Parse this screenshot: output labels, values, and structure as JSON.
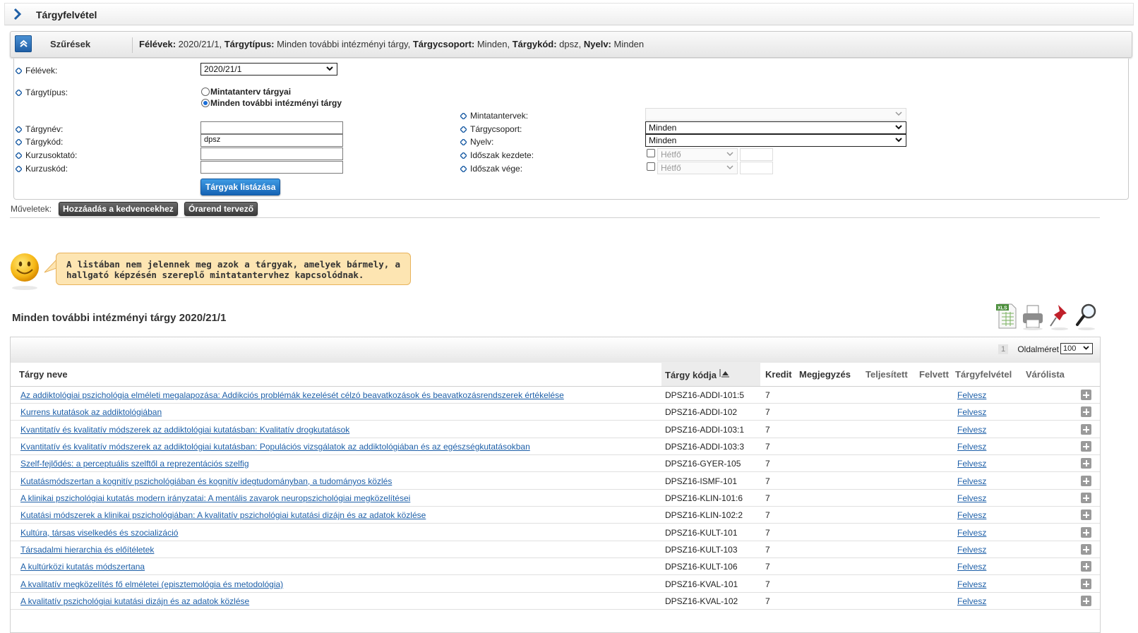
{
  "page": {
    "title": "Tárgyfelvétel"
  },
  "filter": {
    "label": "Szűrések",
    "summary": [
      {
        "key": "Félévek:",
        "value": " 2020/21/1, "
      },
      {
        "key": "Tárgytípus:",
        "value": " Minden további intézményi tárgy, "
      },
      {
        "key": "Tárgycsoport:",
        "value": " Minden, "
      },
      {
        "key": "Tárgykód:",
        "value": " dpsz, "
      },
      {
        "key": "Nyelv:",
        "value": " Minden"
      }
    ],
    "felevek_label": "Félévek:",
    "felevek_value": "2020/21/1",
    "targytipus_label": "Tárgytípus:",
    "radio_1": "Mintatanterv tárgyai",
    "radio_2": "Minden további intézményi tárgy",
    "targynev_label": "Tárgynév:",
    "targykod_label": "Tárgykód:",
    "targykod_value": "dpsz",
    "kurzusoktato_label": "Kurzusoktató:",
    "kurzuskod_label": "Kurzuskód:",
    "mintatantervek_label": "Mintatantervek:",
    "targycsoport_label": "Tárgycsoport:",
    "targycsoport_value": "Minden",
    "nyelv_label": "Nyelv:",
    "nyelv_value": "Minden",
    "idoszak_kezdete_label": "Időszak kezdete:",
    "idoszak_vege_label": "Időszak vége:",
    "day_placeholder": "Hétfő",
    "list_button": "Tárgyak listázása"
  },
  "operations": {
    "label": "Műveletek:",
    "add_fav": "Hozzáadás a kedvencekhez",
    "timetable": "Órarend tervező"
  },
  "notice": "A listában nem jelennek meg azok a tárgyak, amelyek bármely, a hallgató képzésén szereplő mintatantervhez kapcsolódnak.",
  "list": {
    "title": "Minden további intézményi tárgy 2020/21/1",
    "page_number": "1",
    "page_size_label": "Oldalméret",
    "page_size_value": "100",
    "columns": {
      "name": "Tárgy neve",
      "code": "Tárgy kódja",
      "credit": "Kredit",
      "note": "Megjegyzés",
      "completed": "Teljesített",
      "taken": "Felvett",
      "enroll": "Tárgyfelvétel",
      "waitlist": "Várólista"
    },
    "rows": [
      {
        "name": "Az addiktológiai pszichológia elméleti megalapozása: Addikciós problémák kezelését célzó beavatkozások és beavatkozásrendszerek értékelése",
        "code": "DPSZ16-ADDI-101:5",
        "credit": "7",
        "action": "Felvesz"
      },
      {
        "name": "Kurrens kutatások az addiktológiában",
        "code": "DPSZ16-ADDI-102",
        "credit": "7",
        "action": "Felvesz"
      },
      {
        "name": "Kvantitatív és kvalitatív módszerek az addiktológiai kutatásban: Kvalitatív drogkutatások",
        "code": "DPSZ16-ADDI-103:1",
        "credit": "7",
        "action": "Felvesz"
      },
      {
        "name": "Kvantitatív és kvalitatív módszerek az addiktológiai kutatásban: Populációs vizsgálatok az addiktológiában és az egészségkutatásokban",
        "code": "DPSZ16-ADDI-103:3",
        "credit": "7",
        "action": "Felvesz"
      },
      {
        "name": "Szelf-fejlődés: a perceptuális szelftől a reprezentációs szelfig",
        "code": "DPSZ16-GYER-105",
        "credit": "7",
        "action": "Felvesz"
      },
      {
        "name": "Kutatásmódszertan a kognitív pszichológiában és kognitív idegtudományban, a tudományos közlés",
        "code": "DPSZ16-ISMF-101",
        "credit": "7",
        "action": "Felvesz"
      },
      {
        "name": "A klinikai pszichológiai kutatás modern irányzatai: A mentális zavarok neuropszichológiai megközelítései",
        "code": "DPSZ16-KLIN-101:6",
        "credit": "7",
        "action": "Felvesz"
      },
      {
        "name": "Kutatási módszerek a klinikai pszichológiában: A kvalitatív pszichológiai kutatási dizájn és az adatok közlése",
        "code": "DPSZ16-KLIN-102:2",
        "credit": "7",
        "action": "Felvesz"
      },
      {
        "name": "Kultúra, társas viselkedés és szocializáció",
        "code": "DPSZ16-KULT-101",
        "credit": "7",
        "action": "Felvesz"
      },
      {
        "name": "Társadalmi hierarchia és előítéletek",
        "code": "DPSZ16-KULT-103",
        "credit": "7",
        "action": "Felvesz"
      },
      {
        "name": "A kultúrközi kutatás módszertana",
        "code": "DPSZ16-KULT-106",
        "credit": "7",
        "action": "Felvesz"
      },
      {
        "name": "A kvalitatív megközelítés fő elméletei (episztemológia és metodológia)",
        "code": "DPSZ16-KVAL-101",
        "credit": "7",
        "action": "Felvesz"
      },
      {
        "name": "A kvalitatív pszichológiai kutatási dizájn és az adatok közlése",
        "code": "DPSZ16-KVAL-102",
        "credit": "7",
        "action": "Felvesz"
      }
    ]
  },
  "icons": [
    "chevron-right-icon",
    "collapse-icon",
    "excel-icon",
    "print-icon",
    "pin-icon",
    "search-icon",
    "smiley-icon",
    "plus-icon"
  ],
  "colors": {
    "accent": "#1f5fa6",
    "link": "#1d5fa8",
    "notice_bg": "#fde5b2"
  }
}
